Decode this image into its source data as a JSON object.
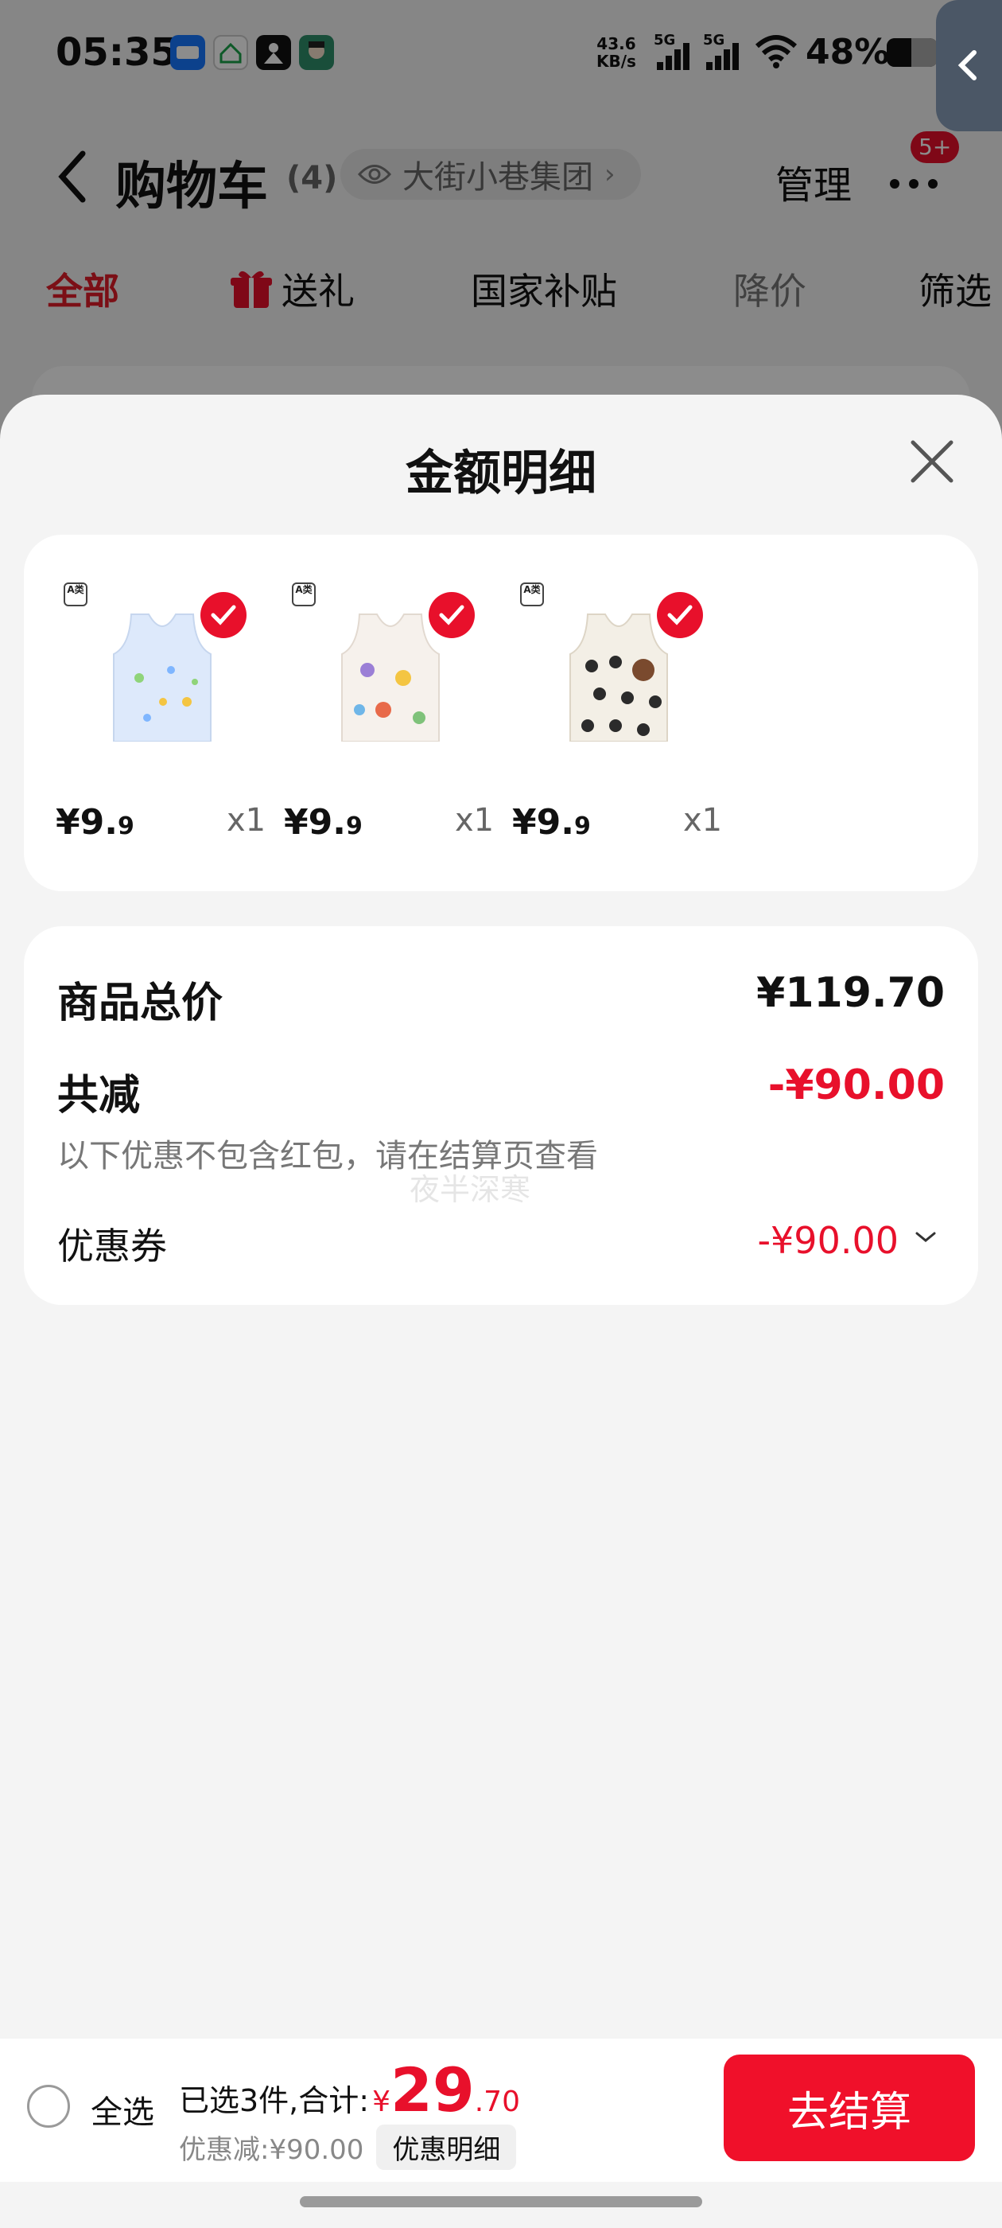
{
  "status_bar": {
    "time": "05:35",
    "net_speed_value": "43.6",
    "net_speed_unit": "KB/s",
    "signal_1": "5G",
    "signal_2": "5G",
    "battery_percent": "48%",
    "app_icons": [
      "alipay-icon",
      "smart-home-icon",
      "app-icon",
      "avatar-app-icon"
    ]
  },
  "header": {
    "title": "购物车",
    "count": "(4)",
    "store_name": "大街小巷集团",
    "manage_label": "管理",
    "more_badge": "5+"
  },
  "filter_tabs": [
    {
      "label": "全部",
      "active": true
    },
    {
      "label": "送礼",
      "icon": "gift-icon"
    },
    {
      "label": "国家补贴"
    },
    {
      "label": "降价"
    },
    {
      "label": "筛选"
    }
  ],
  "sheet": {
    "title": "金额明细",
    "products": [
      {
        "tag": "A类",
        "price_main": "¥9.",
        "price_cents": "9",
        "qty": "x1",
        "checked": true
      },
      {
        "tag": "A类",
        "price_main": "¥9.",
        "price_cents": "9",
        "qty": "x1",
        "checked": true
      },
      {
        "tag": "A类",
        "price_main": "¥9.",
        "price_cents": "9",
        "qty": "x1",
        "checked": true
      }
    ],
    "totals": {
      "total_price_label": "商品总价",
      "total_price_value": "¥119.70",
      "discount_label": "共减",
      "discount_value": "-¥90.00",
      "discount_note": "以下优惠不包含红包，请在结算页查看",
      "coupon_label": "优惠券",
      "coupon_value": "-¥90.00",
      "watermark": "夜半深寒"
    }
  },
  "bottom_bar": {
    "select_all_label": "全选",
    "selected_text": "已选3件,合计:",
    "currency": "¥",
    "total_integer": "29",
    "total_cents": ".70",
    "discount_text": "优惠减:¥90.00",
    "detail_button_label": "优惠明细",
    "checkout_label": "去结算"
  },
  "colors": {
    "accent_red": "#e8102b",
    "sheet_background": "#f4f4f4",
    "card_background": "#ffffff"
  }
}
